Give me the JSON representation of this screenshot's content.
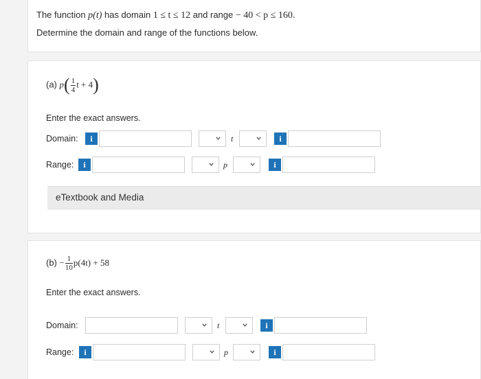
{
  "header": {
    "text_1": "The function ",
    "fn": "p(t)",
    "text_2": " has domain ",
    "domain_expr": "1 ≤ t ≤ 12",
    "text_3": " and range ",
    "range_expr": "− 40 < p ≤ 160.",
    "instruction": "Determine the domain and range of the functions below."
  },
  "part_a": {
    "label": "(a)",
    "fn_var": "p",
    "frac_num": "1",
    "frac_den": "4",
    "expr_tail": "t + 4",
    "enter_text": "Enter the exact answers.",
    "domain_label": "Domain:",
    "range_label": "Range:",
    "domain_var": "t",
    "range_var": "p",
    "etextbook": "eTextbook and Media"
  },
  "part_b": {
    "label": "(b)",
    "sign": "−",
    "frac_num": "1",
    "frac_den": "10",
    "expr_tail": "p(4t) + 58",
    "enter_text": "Enter the exact answers.",
    "domain_label": "Domain:",
    "range_label": "Range:",
    "domain_var": "t",
    "range_var": "p"
  },
  "icons": {
    "info": "info-icon",
    "chevron": "chevron-down-icon"
  },
  "info_glyph": "i",
  "colors": {
    "info_button": "#1f73b7",
    "background": "#f3f3f3"
  }
}
